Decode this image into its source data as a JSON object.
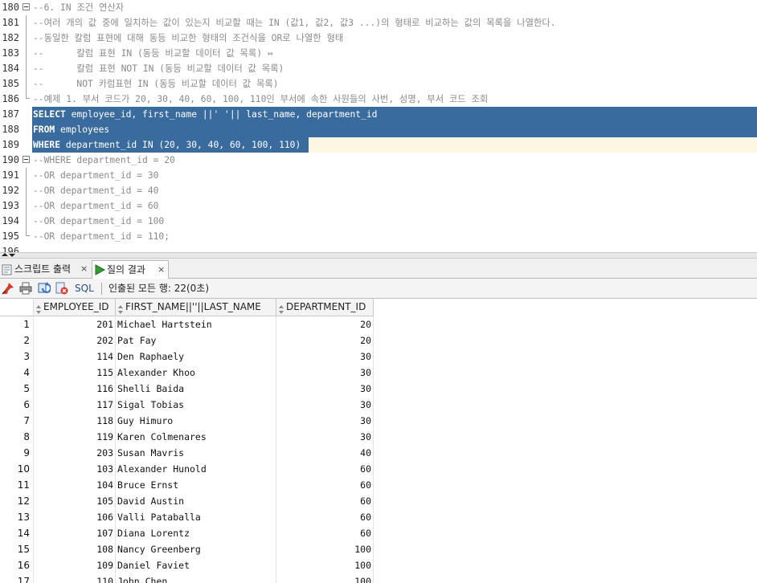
{
  "editor": {
    "lines": [
      {
        "num": "180",
        "text": "--6. IN 조건 연산자",
        "fold": "box"
      },
      {
        "num": "181",
        "text": "--여러 개의 값 중에 일치하는 값이 있는지 비교할 때는 IN (값1, 값2, 값3 ...)의 형태로 비교하는 값의 목록을 나열한다.",
        "fold": "vline"
      },
      {
        "num": "182",
        "text": "--동일한 칼럼 표현에 대해 동등 비교한 형태의 조건식을 OR로 나열한 형태",
        "fold": "vline"
      },
      {
        "num": "183",
        "text": "--      칼럼 표현 IN (동등 비교할 데이터 값 목록) ↔",
        "fold": "vline"
      },
      {
        "num": "184",
        "text": "--      칼럼 표현 NOT IN (동등 비교할 데이터 값 목록)",
        "fold": "vline"
      },
      {
        "num": "185",
        "text": "--      NOT 카럼표현 IN (동등 비교할 데이터 값 목록)",
        "fold": "vline"
      },
      {
        "num": "186",
        "text": "--예제 1. 부서 코드가 20, 30, 40, 60, 100, 110인 부서에 속한 사원들의 사번, 성명, 부서 코드 조회",
        "fold": "end"
      },
      {
        "num": "187",
        "kw": "SELECT",
        "rest": " employee_id, first_name ||' '|| last_name, department_id",
        "fold": "none",
        "selected": true
      },
      {
        "num": "188",
        "kw": "FROM",
        "rest": " employees",
        "fold": "none",
        "selected": true
      },
      {
        "num": "189",
        "kw": "WHERE",
        "rest": " department_id IN (20, 30, 40, 60, 100, 110)",
        "fold": "none",
        "selected": true,
        "current": true
      },
      {
        "num": "190",
        "text": "--WHERE department_id = 20",
        "fold": "box"
      },
      {
        "num": "191",
        "text": "--OR department_id = 30",
        "fold": "vline"
      },
      {
        "num": "192",
        "text": "--OR department_id = 40",
        "fold": "vline"
      },
      {
        "num": "193",
        "text": "--OR department_id = 60",
        "fold": "vline"
      },
      {
        "num": "194",
        "text": "--OR department_id = 100",
        "fold": "vline"
      },
      {
        "num": "195",
        "text": "--OR department_id = 110;",
        "fold": "end"
      },
      {
        "num": "196",
        "text": "",
        "fold": "none"
      }
    ],
    "selection_color": "#3a6b9f",
    "comment_color": "#8a8a8a"
  },
  "tabs": [
    {
      "label": "스크립트 출력",
      "close": "×",
      "icon": "script-output-icon"
    },
    {
      "label": "질의 결과",
      "close": "×",
      "icon": "run-query-icon",
      "active": true
    }
  ],
  "toolbar": {
    "icons": [
      "pin-icon",
      "print-icon",
      "refresh-icon",
      "cancel-fetch-icon"
    ],
    "sql_label": "SQL",
    "status": "인출된 모든 행: 22(0초)"
  },
  "grid": {
    "columns": [
      "EMPLOYEE_ID",
      "FIRST_NAME||''||LAST_NAME",
      "DEPARTMENT_ID"
    ],
    "rows": [
      {
        "n": "1",
        "id": "201",
        "name": "Michael Hartstein",
        "dept": "20"
      },
      {
        "n": "2",
        "id": "202",
        "name": "Pat Fay",
        "dept": "20"
      },
      {
        "n": "3",
        "id": "114",
        "name": "Den Raphaely",
        "dept": "30"
      },
      {
        "n": "4",
        "id": "115",
        "name": "Alexander Khoo",
        "dept": "30"
      },
      {
        "n": "5",
        "id": "116",
        "name": "Shelli Baida",
        "dept": "30"
      },
      {
        "n": "6",
        "id": "117",
        "name": "Sigal Tobias",
        "dept": "30"
      },
      {
        "n": "7",
        "id": "118",
        "name": "Guy Himuro",
        "dept": "30"
      },
      {
        "n": "8",
        "id": "119",
        "name": "Karen Colmenares",
        "dept": "30"
      },
      {
        "n": "9",
        "id": "203",
        "name": "Susan Mavris",
        "dept": "40"
      },
      {
        "n": "10",
        "id": "103",
        "name": "Alexander Hunold",
        "dept": "60"
      },
      {
        "n": "11",
        "id": "104",
        "name": "Bruce Ernst",
        "dept": "60"
      },
      {
        "n": "12",
        "id": "105",
        "name": "David Austin",
        "dept": "60"
      },
      {
        "n": "13",
        "id": "106",
        "name": "Valli Pataballa",
        "dept": "60"
      },
      {
        "n": "14",
        "id": "107",
        "name": "Diana Lorentz",
        "dept": "60"
      },
      {
        "n": "15",
        "id": "108",
        "name": "Nancy Greenberg",
        "dept": "100"
      },
      {
        "n": "16",
        "id": "109",
        "name": "Daniel Faviet",
        "dept": "100"
      },
      {
        "n": "17",
        "id": "110",
        "name": "John Chen",
        "dept": "100"
      }
    ]
  }
}
